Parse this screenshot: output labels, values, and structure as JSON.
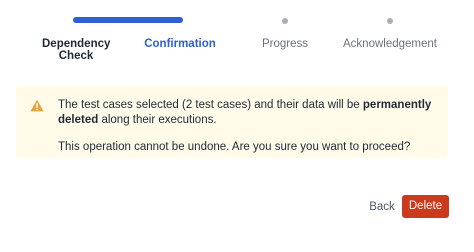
{
  "stepper": {
    "steps": [
      {
        "label": "Dependency Check",
        "line1": "Dependency",
        "line2": "Check",
        "state": "completed"
      },
      {
        "label": "Confirmation",
        "state": "active"
      },
      {
        "label": "Progress",
        "state": "pending"
      },
      {
        "label": "Acknowledgement",
        "state": "pending"
      }
    ]
  },
  "alert": {
    "icon": "warning-icon",
    "line1_prefix": "The test cases selected (2 test cases) and their data will be ",
    "line1_bold": "permanently deleted",
    "line1_suffix": " along their executions.",
    "line2": "This operation cannot be undone. Are you sure you want to proceed?"
  },
  "actions": {
    "back_label": "Back",
    "delete_label": "Delete"
  },
  "colors": {
    "accent": "#2f5fd0",
    "warning_bg": "#fffbe8",
    "warning_icon": "#e8a33d",
    "danger": "#cc3a1e"
  }
}
